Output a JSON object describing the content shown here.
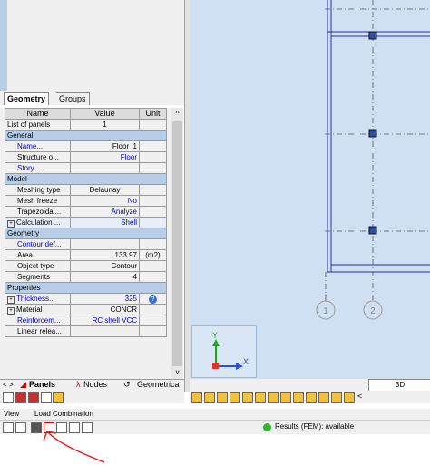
{
  "panel_tabs": {
    "geometry": "Geometry",
    "groups": "Groups"
  },
  "grid": {
    "columns": [
      "Name",
      "Value",
      "Unit"
    ],
    "list_of_panels": {
      "name": "List of panels",
      "value": "1"
    },
    "sections": {
      "general": "General",
      "model": "Model",
      "geometry": "Geometry",
      "properties": "Properties"
    },
    "rows": {
      "name": {
        "label": "Name...",
        "value": "Floor_1"
      },
      "structure": {
        "label": "Structure o...",
        "value": "Floor"
      },
      "story": {
        "label": "Story..."
      },
      "meshing": {
        "label": "Meshing type",
        "value": "Delaunay"
      },
      "freeze": {
        "label": "Mesh freeze",
        "value": "No"
      },
      "trap": {
        "label": "Trapezoidal...",
        "value": "Analyze"
      },
      "calc": {
        "label": "Calculation ...",
        "value": "Shell"
      },
      "contour": {
        "label": "Contour def..."
      },
      "area": {
        "label": "Area",
        "value": "133.97",
        "unit": "(m2)"
      },
      "objtype": {
        "label": "Object type",
        "value": "Contour"
      },
      "segments": {
        "label": "Segments",
        "value": "4"
      },
      "thickness": {
        "label": "Thickness...",
        "value": "325"
      },
      "material": {
        "label": "Material",
        "value": "CONCR"
      },
      "reinf": {
        "label": "Reinforcem...",
        "value": "RC shell VCC"
      },
      "linear": {
        "label": "Linear relea..."
      }
    }
  },
  "bottom_tabs": {
    "panels": "Panels",
    "nodes": "Nodes",
    "geometrical": "Geometrica"
  },
  "view": {
    "axis_labels": {
      "y": "Y",
      "x": "X"
    },
    "grid_labels": [
      "1",
      "2"
    ],
    "btn_3d": "3D",
    "scroll_left": "<"
  },
  "menu": {
    "view": "View",
    "load_combination": "Load Combination"
  },
  "status": {
    "results": "Results (FEM): available",
    "result_color": "#2db82d"
  }
}
